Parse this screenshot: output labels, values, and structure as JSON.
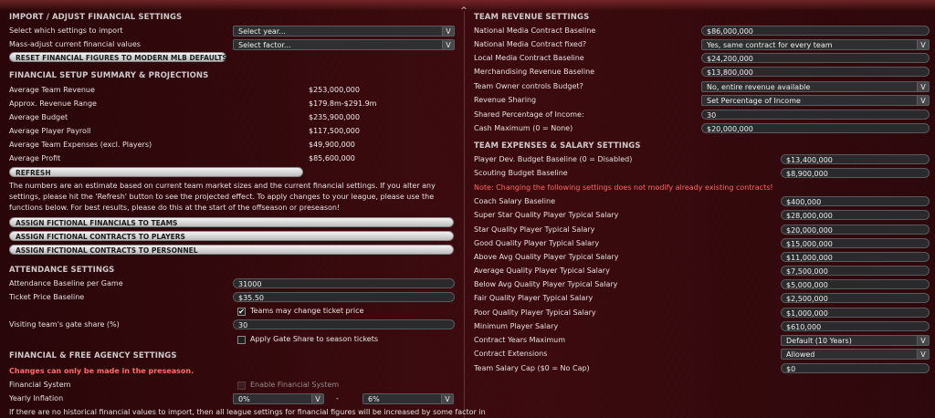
{
  "left": {
    "import": {
      "header": "IMPORT / ADJUST FINANCIAL SETTINGS",
      "select_label": "Select which settings to import",
      "select_value": "Select year...",
      "mass_label": "Mass-adjust current financial values",
      "mass_value": "Select factor...",
      "reset_button": "RESET FINANCIAL FIGURES TO MODERN MLB DEFAULTS"
    },
    "summary": {
      "header": "FINANCIAL SETUP SUMMARY & PROJECTIONS",
      "rows": [
        {
          "label": "Average Team Revenue",
          "value": "$253,000,000"
        },
        {
          "label": "Approx. Revenue Range",
          "value": "$179.8m-$291.9m"
        },
        {
          "label": "Average Budget",
          "value": "$235,900,000"
        },
        {
          "label": "Average Player Payroll",
          "value": "$117,500,000"
        },
        {
          "label": "Average Team Expenses (excl. Players)",
          "value": "$49,900,000"
        },
        {
          "label": "Average Profit",
          "value": "$85,600,000"
        }
      ],
      "refresh_button": "REFRESH",
      "note": "The numbers are an estimate based on current team market sizes and the current financial settings. If you alter any settings, please hit the 'Refresh' button to see the projected effect. To apply changes to your league, please use the functions below. For best results, please do this at the start of the offseason or preseason!",
      "assign_buttons": [
        "ASSIGN FICTIONAL FINANCIALS TO TEAMS",
        "ASSIGN FICTIONAL CONTRACTS TO PLAYERS",
        "ASSIGN FICTIONAL CONTRACTS TO PERSONNEL"
      ]
    },
    "attendance": {
      "header": "ATTENDANCE SETTINGS",
      "baseline_label": "Attendance Baseline per Game",
      "baseline_value": "31000",
      "ticket_label": "Ticket Price Baseline",
      "ticket_value": "$35.50",
      "teams_change_label": "Teams may change ticket price",
      "teams_change_checked": true,
      "gate_label": "Visiting team's gate share (%)",
      "gate_value": "30",
      "apply_gate_label": "Apply Gate Share to season tickets",
      "apply_gate_checked": false
    },
    "free_agency": {
      "header": "FINANCIAL & FREE AGENCY SETTINGS",
      "warning": "Changes can only be made in the preseason.",
      "system_label": "Financial System",
      "enable_label": "Enable Financial System",
      "inflation_label": "Yearly Inflation",
      "inflation_min": "0%",
      "dash": "-",
      "inflation_max": "6%",
      "bottom_note": "If there are no historical financial values to import, then all league settings for financial figures will be increased by some factor in"
    }
  },
  "right": {
    "revenue": {
      "header": "TEAM REVENUE SETTINGS",
      "rows": [
        {
          "label": "National Media Contract Baseline",
          "value": "$86,000,000",
          "kind": "field"
        },
        {
          "label": "National Media Contract fixed?",
          "value": "Yes, same contract for every team",
          "kind": "select"
        },
        {
          "label": "Local Media Contract Baseline",
          "value": "$24,200,000",
          "kind": "field"
        },
        {
          "label": "Merchandising Revenue Baseline",
          "value": "$13,800,000",
          "kind": "field"
        },
        {
          "label": "Team Owner controls Budget?",
          "value": "No, entire revenue available",
          "kind": "select"
        },
        {
          "label": "Revenue Sharing",
          "value": "Set Percentage of Income",
          "kind": "select"
        },
        {
          "label": "Shared Percentage of Income:",
          "value": "30",
          "kind": "field"
        },
        {
          "label": "Cash Maximum (0 = None)",
          "value": "$20,000,000",
          "kind": "field"
        }
      ]
    },
    "expenses": {
      "header": "TEAM EXPENSES & SALARY SETTINGS",
      "rows_top": [
        {
          "label": "Player Dev. Budget Baseline (0 = Disabled)",
          "value": "$13,400,000",
          "kind": "field"
        },
        {
          "label": "Scouting Budget Baseline",
          "value": "$8,900,000",
          "kind": "field"
        }
      ],
      "note": "Note: Changing the following settings does not modify already existing contracts!",
      "rows": [
        {
          "label": "Coach Salary Baseline",
          "value": "$400,000",
          "kind": "field"
        },
        {
          "label": "Super Star Quality Player Typical Salary",
          "value": "$28,000,000",
          "kind": "field"
        },
        {
          "label": "Star Quality Player Typical Salary",
          "value": "$20,000,000",
          "kind": "field"
        },
        {
          "label": "Good Quality Player Typical Salary",
          "value": "$15,000,000",
          "kind": "field"
        },
        {
          "label": "Above Avg Quality Player Typical Salary",
          "value": "$11,000,000",
          "kind": "field"
        },
        {
          "label": "Average Quality Player Typical Salary",
          "value": "$7,500,000",
          "kind": "field"
        },
        {
          "label": "Below Avg Quality Player Typical Salary",
          "value": "$5,000,000",
          "kind": "field"
        },
        {
          "label": "Fair Quality Player Typical Salary",
          "value": "$2,500,000",
          "kind": "field"
        },
        {
          "label": "Poor Quality Player Typical Salary",
          "value": "$1,000,000",
          "kind": "field"
        },
        {
          "label": "Minimum Player Salary",
          "value": "$610,000",
          "kind": "field"
        },
        {
          "label": "Contract Years Maximum",
          "value": "Default (10 Years)",
          "kind": "select"
        },
        {
          "label": "Contract Extensions",
          "value": "Allowed",
          "kind": "select"
        },
        {
          "label": "Team Salary Cap ($0 = No Cap)",
          "value": "$0",
          "kind": "field"
        }
      ]
    }
  },
  "icons": {
    "select_arrow": "V",
    "checkmark": "✔",
    "scroll_caret": "^"
  }
}
